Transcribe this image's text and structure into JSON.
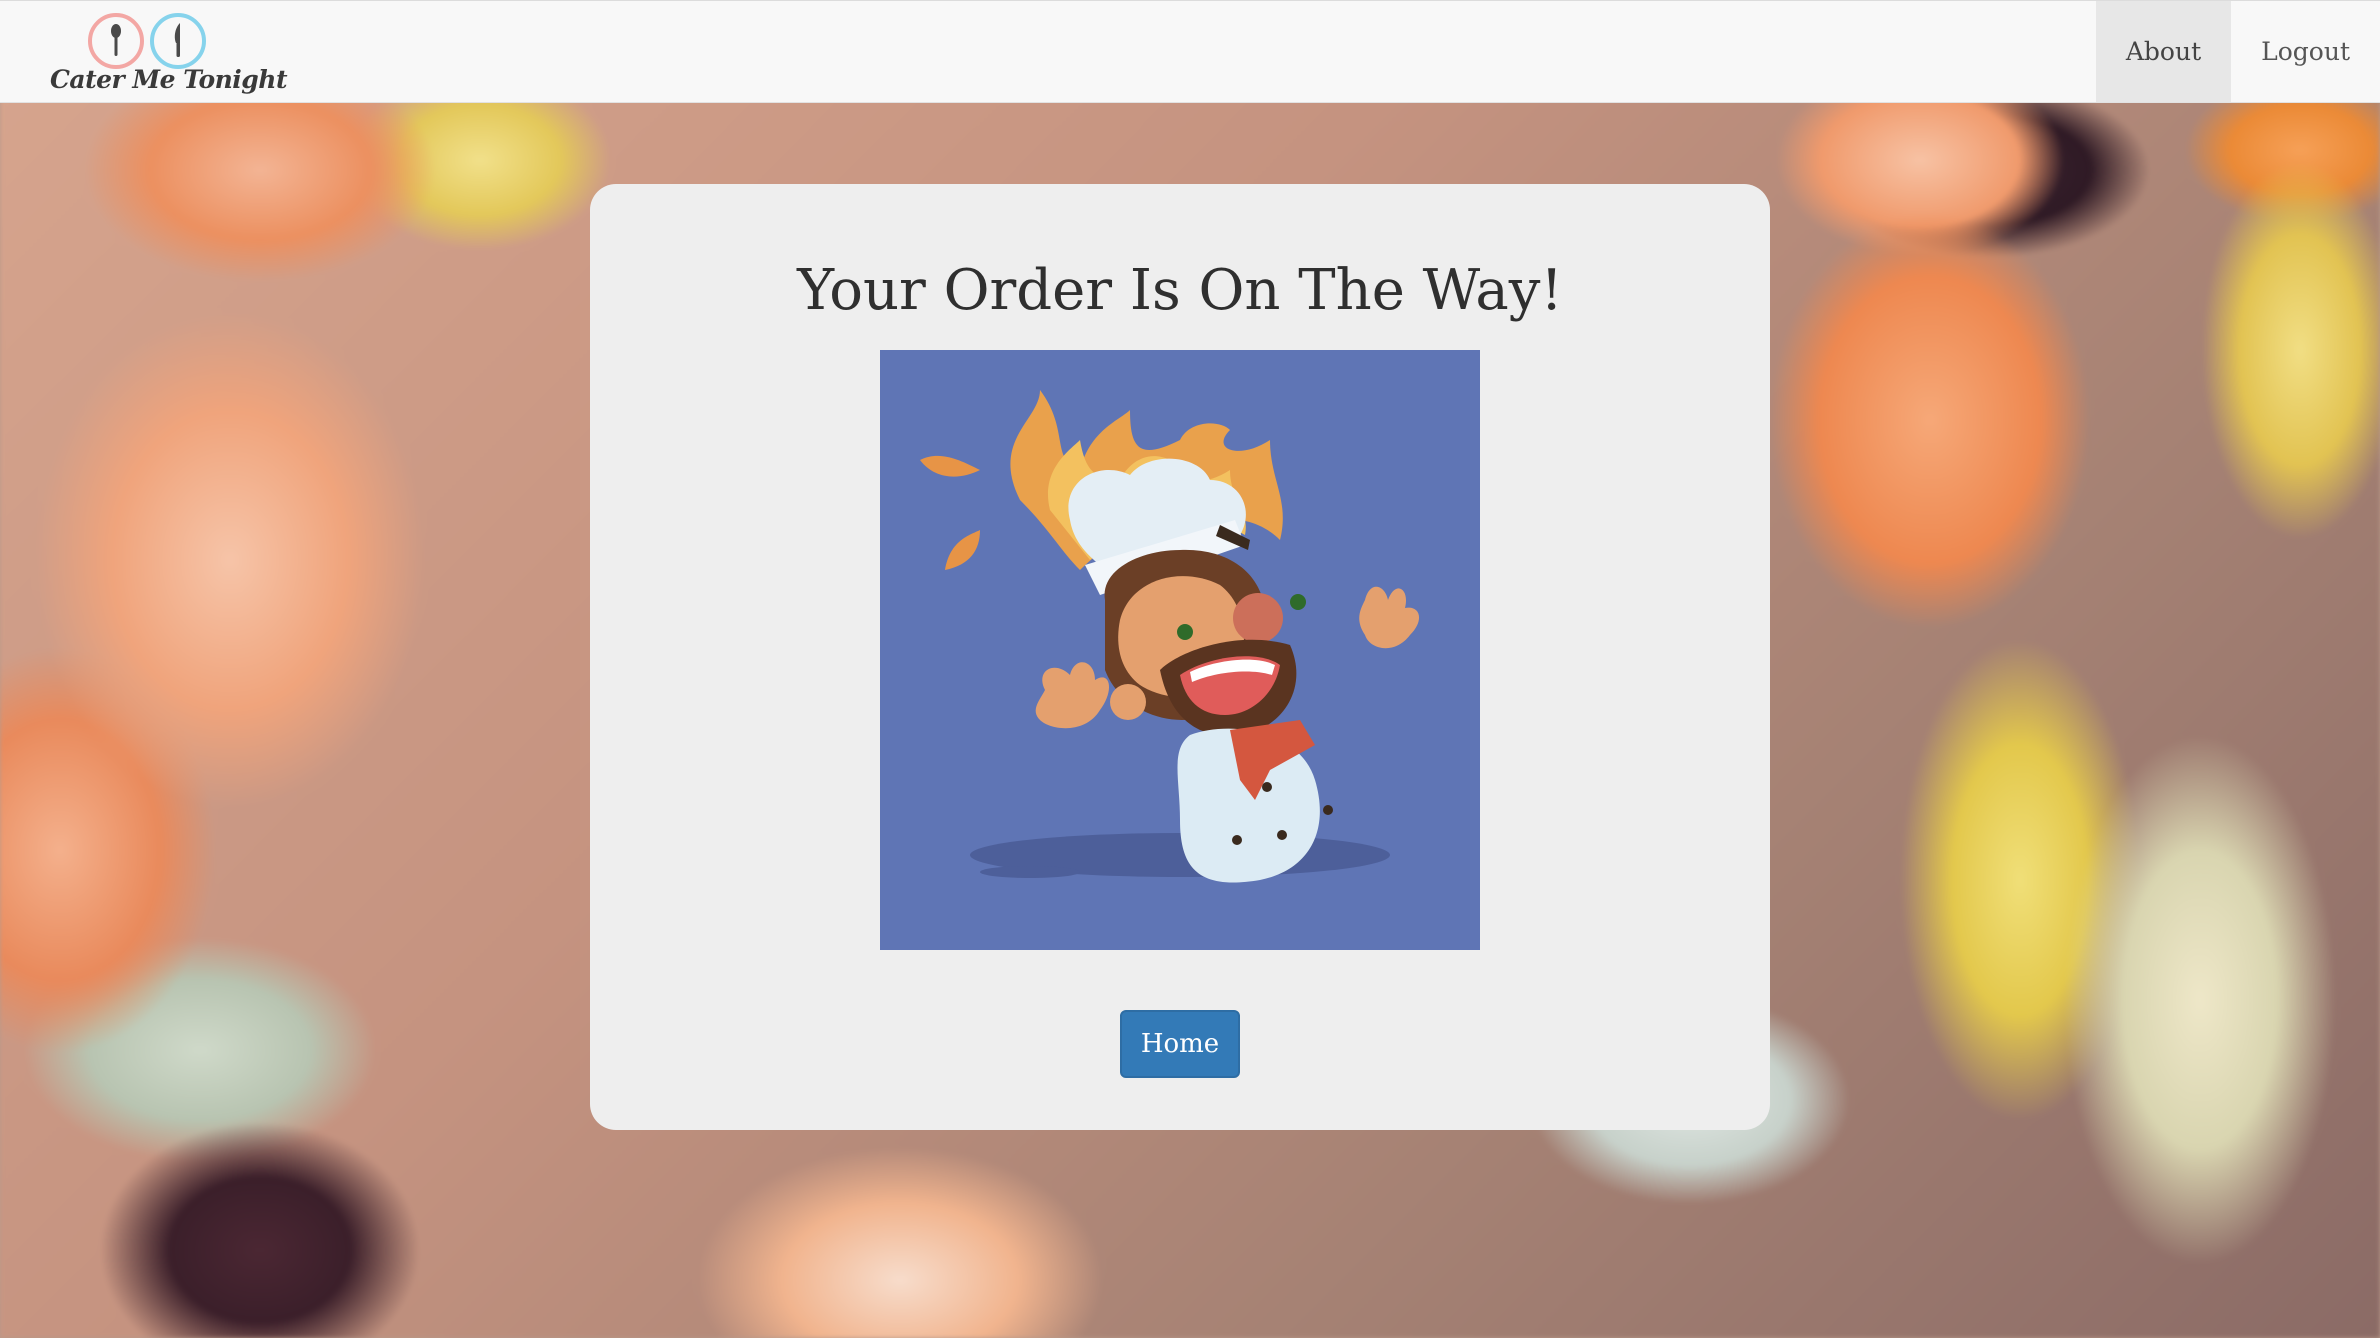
{
  "brand": {
    "name": "Cater Me Tonight",
    "logo_icons": [
      "spoon-icon",
      "knife-icon"
    ]
  },
  "nav": {
    "items": [
      {
        "label": "About",
        "active": true
      },
      {
        "label": "Logout",
        "active": false
      }
    ]
  },
  "main": {
    "title": "Your Order Is On The Way!",
    "image_icon": "panicked-chef-on-fire-illustration",
    "home_button": "Home"
  },
  "colors": {
    "navbar_bg": "#f8f8f8",
    "card_bg": "#eeeeee",
    "image_bg": "#5f75b5",
    "button_primary": "#337ab7",
    "logo_pink": "#f3a7a4",
    "logo_blue": "#86d3ec"
  }
}
